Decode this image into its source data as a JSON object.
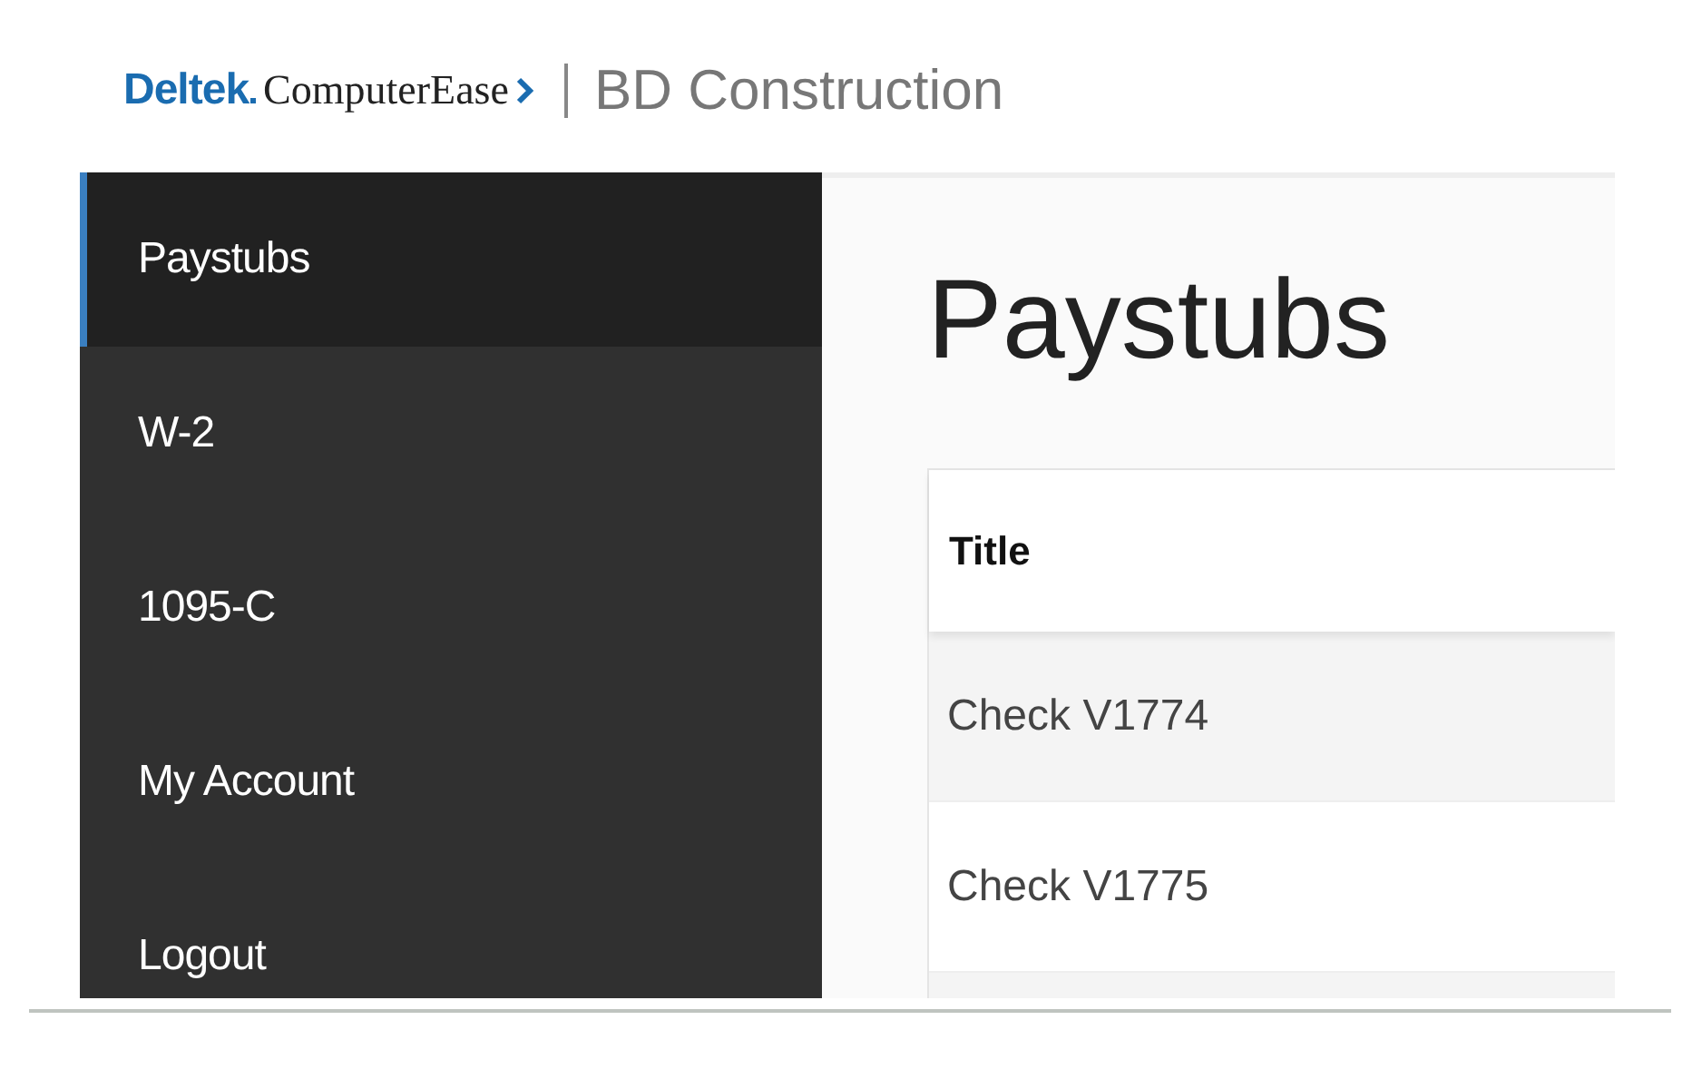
{
  "header": {
    "brand": "Deltek",
    "product": "ComputerEase",
    "company": "BD Construction"
  },
  "sidebar": {
    "items": [
      {
        "label": "Paystubs",
        "selected": true
      },
      {
        "label": "W-2",
        "selected": false
      },
      {
        "label": "1095-C",
        "selected": false
      },
      {
        "label": "My Account",
        "selected": false
      },
      {
        "label": "Logout",
        "selected": false
      }
    ]
  },
  "page_title": "Paystubs",
  "table": {
    "columns": [
      "Title"
    ],
    "rows": [
      [
        "Check V1774"
      ],
      [
        "Check V1775"
      ]
    ]
  }
}
